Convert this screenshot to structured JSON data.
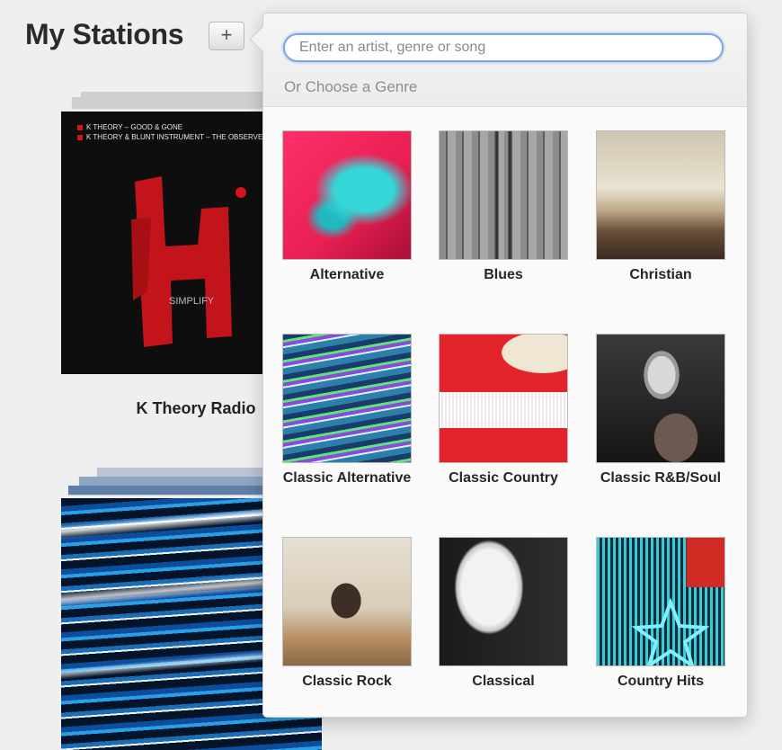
{
  "header": {
    "title": "My Stations",
    "add_label": "+"
  },
  "stations": [
    {
      "name": "K Theory Radio",
      "art_text_lines": [
        "K THEORY – GOOD & GONE",
        "K THEORY & BLUNT INSTRUMENT – THE OBSERVER"
      ],
      "art_logo": "SIMPLIFY"
    },
    {
      "name": ""
    }
  ],
  "popover": {
    "search_placeholder": "Enter an artist, genre or song",
    "search_value": "",
    "genre_heading": "Or Choose a Genre",
    "genres": [
      {
        "label": "Alternative",
        "image": "alternative-art"
      },
      {
        "label": "Blues",
        "image": "blues-art"
      },
      {
        "label": "Christian",
        "image": "christian-art"
      },
      {
        "label": "Classic Alternative",
        "image": "classic-alternative-art"
      },
      {
        "label": "Classic Country",
        "image": "classic-country-art"
      },
      {
        "label": "Classic R&B/Soul",
        "image": "classic-rnb-soul-art"
      },
      {
        "label": "Classic Rock",
        "image": "classic-rock-art"
      },
      {
        "label": "Classical",
        "image": "classical-art"
      },
      {
        "label": "Country Hits",
        "image": "country-hits-art"
      }
    ]
  },
  "colors": {
    "accent_focus": "#7fa7e3",
    "background": "#efefef",
    "kt_red": "#d01818"
  }
}
